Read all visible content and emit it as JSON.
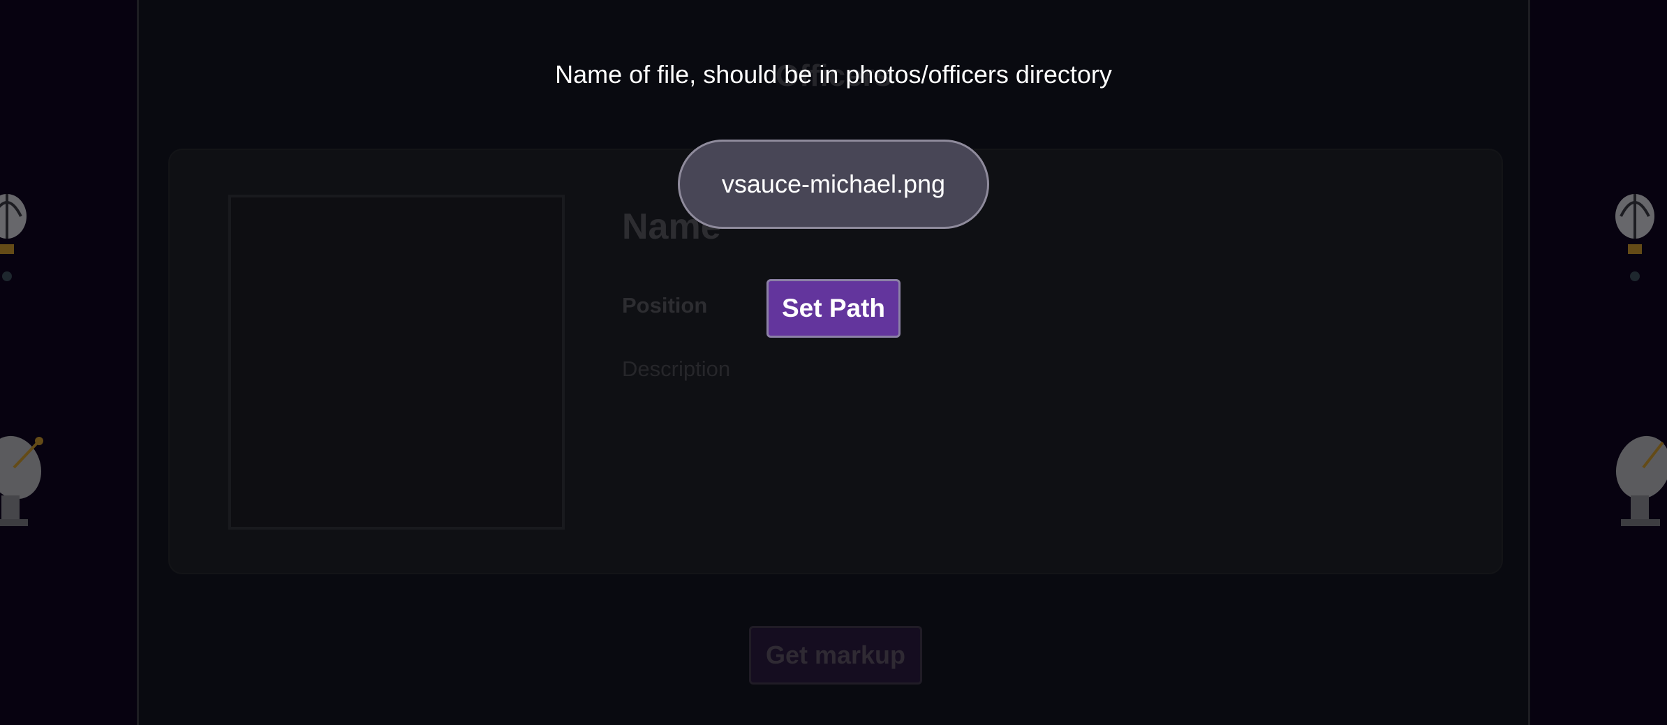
{
  "page": {
    "title": "Officers"
  },
  "officer_card": {
    "name": "Name",
    "position": "Position",
    "description": "Description"
  },
  "markup_button": {
    "label": "Get markup"
  },
  "modal": {
    "prompt": "Name of file, should be in photos/officers directory",
    "path_value": "vsauce-michael.png",
    "set_path_label": "Set Path"
  },
  "decorations": {
    "left": [
      "hot-air-balloon-icon",
      "satellite-dish-icon"
    ],
    "right": [
      "hot-air-balloon-icon",
      "satellite-dish-icon"
    ]
  },
  "colors": {
    "background": "#0c0519",
    "panel": "#131520",
    "card": "#1e2028",
    "accent": "#63359d",
    "input_bg": "#484656"
  }
}
